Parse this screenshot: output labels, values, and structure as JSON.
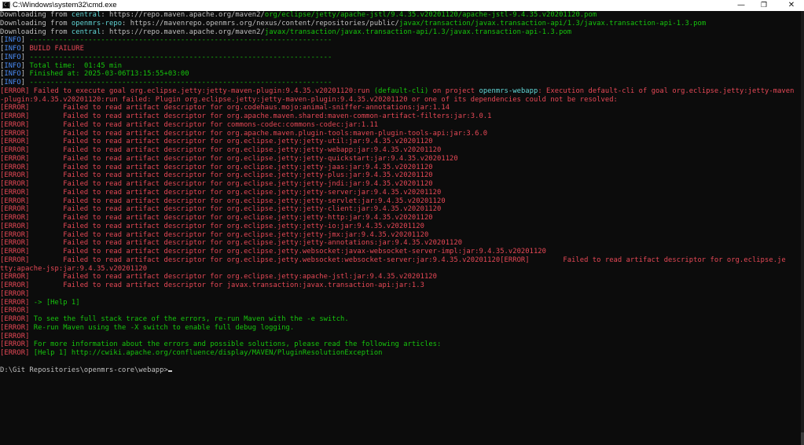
{
  "window": {
    "title": "C:\\Windows\\system32\\cmd.exe",
    "icon": "cmd-icon",
    "icon_glyph": "C:\\",
    "controls": {
      "minimize": "—",
      "maximize": "❐",
      "close": "✕"
    }
  },
  "colors": {
    "background": "#0c0c0c",
    "gray": "#c0c0c0",
    "green": "#16c60c",
    "cyan": "#61d6d6",
    "blue": "#4a8cf7",
    "red": "#e74856",
    "white": "#f2f2f2"
  },
  "console": {
    "lines": [
      [
        {
          "t": "Downloading from ",
          "c": "gray"
        },
        {
          "t": "central",
          "c": "cyan"
        },
        {
          "t": ": https://repo.maven.apache.org/maven2/",
          "c": "gray"
        },
        {
          "t": "org/eclipse/jetty/apache-jstl/9.4.35.v20201120/apache-jstl-9.4.35.v20201120.pom",
          "c": "green"
        }
      ],
      [
        {
          "t": "Downloading from ",
          "c": "gray"
        },
        {
          "t": "openmrs-repo",
          "c": "cyan"
        },
        {
          "t": ": https://mavenrepo.openmrs.org/nexus/content/repositories/public/",
          "c": "gray"
        },
        {
          "t": "javax/transaction/javax.transaction-api/1.3/javax.transaction-api-1.3.pom",
          "c": "green"
        }
      ],
      [
        {
          "t": "Downloading from ",
          "c": "gray"
        },
        {
          "t": "central",
          "c": "cyan"
        },
        {
          "t": ": https://repo.maven.apache.org/maven2/",
          "c": "gray"
        },
        {
          "t": "javax/transaction/javax.transaction-api/1.3/javax.transaction-api-1.3.pom",
          "c": "green"
        }
      ],
      [
        {
          "t": "[",
          "c": "gray"
        },
        {
          "t": "INFO",
          "c": "blue"
        },
        {
          "t": "] ",
          "c": "gray"
        },
        {
          "t": "------------------------------------------------------------------------",
          "c": "green"
        }
      ],
      [
        {
          "t": "[",
          "c": "gray"
        },
        {
          "t": "INFO",
          "c": "blue"
        },
        {
          "t": "] ",
          "c": "gray"
        },
        {
          "t": "BUILD FAILURE",
          "c": "red"
        }
      ],
      [
        {
          "t": "[",
          "c": "gray"
        },
        {
          "t": "INFO",
          "c": "blue"
        },
        {
          "t": "] ",
          "c": "gray"
        },
        {
          "t": "------------------------------------------------------------------------",
          "c": "green"
        }
      ],
      [
        {
          "t": "[",
          "c": "gray"
        },
        {
          "t": "INFO",
          "c": "blue"
        },
        {
          "t": "] ",
          "c": "gray"
        },
        {
          "t": "Total time:  01:45 min",
          "c": "green"
        }
      ],
      [
        {
          "t": "[",
          "c": "gray"
        },
        {
          "t": "INFO",
          "c": "blue"
        },
        {
          "t": "] ",
          "c": "gray"
        },
        {
          "t": "Finished at: 2025-03-06T13:15:55+03:00",
          "c": "green"
        }
      ],
      [
        {
          "t": "[",
          "c": "gray"
        },
        {
          "t": "INFO",
          "c": "blue"
        },
        {
          "t": "] ",
          "c": "gray"
        },
        {
          "t": "------------------------------------------------------------------------",
          "c": "green"
        }
      ],
      [
        {
          "t": "[ERROR] Failed to execute goal org.eclipse.jetty:jetty-maven-plugin:9.4.35.v20201120:run ",
          "c": "red"
        },
        {
          "t": "(default-cli)",
          "c": "green"
        },
        {
          "t": " on project ",
          "c": "red"
        },
        {
          "t": "openmrs-webapp",
          "c": "cyan"
        },
        {
          "t": ": Execution default-cli of goal org.eclipse.jetty:jetty-maven",
          "c": "red"
        }
      ],
      [
        {
          "t": "-plugin:9.4.35.v20201120:run failed: Plugin org.eclipse.jetty:jetty-maven-plugin:9.4.35.v20201120 or one of its dependencies could not be resolved:",
          "c": "red"
        }
      ],
      [
        {
          "t": "[ERROR]        Failed to read artifact descriptor for org.codehaus.mojo:animal-sniffer-annotations:jar:1.14",
          "c": "red"
        }
      ],
      [
        {
          "t": "[ERROR]        Failed to read artifact descriptor for org.apache.maven.shared:maven-common-artifact-filters:jar:3.0.1",
          "c": "red"
        }
      ],
      [
        {
          "t": "[ERROR]        Failed to read artifact descriptor for commons-codec:commons-codec:jar:1.11",
          "c": "red"
        }
      ],
      [
        {
          "t": "[ERROR]        Failed to read artifact descriptor for org.apache.maven.plugin-tools:maven-plugin-tools-api:jar:3.6.0",
          "c": "red"
        }
      ],
      [
        {
          "t": "[ERROR]        Failed to read artifact descriptor for org.eclipse.jetty:jetty-util:jar:9.4.35.v20201120",
          "c": "red"
        }
      ],
      [
        {
          "t": "[ERROR]        Failed to read artifact descriptor for org.eclipse.jetty:jetty-webapp:jar:9.4.35.v20201120",
          "c": "red"
        }
      ],
      [
        {
          "t": "[ERROR]        Failed to read artifact descriptor for org.eclipse.jetty:jetty-quickstart:jar:9.4.35.v20201120",
          "c": "red"
        }
      ],
      [
        {
          "t": "[ERROR]        Failed to read artifact descriptor for org.eclipse.jetty:jetty-jaas:jar:9.4.35.v20201120",
          "c": "red"
        }
      ],
      [
        {
          "t": "[ERROR]        Failed to read artifact descriptor for org.eclipse.jetty:jetty-plus:jar:9.4.35.v20201120",
          "c": "red"
        }
      ],
      [
        {
          "t": "[ERROR]        Failed to read artifact descriptor for org.eclipse.jetty:jetty-jndi:jar:9.4.35.v20201120",
          "c": "red"
        }
      ],
      [
        {
          "t": "[ERROR]        Failed to read artifact descriptor for org.eclipse.jetty:jetty-server:jar:9.4.35.v20201120",
          "c": "red"
        }
      ],
      [
        {
          "t": "[ERROR]        Failed to read artifact descriptor for org.eclipse.jetty:jetty-servlet:jar:9.4.35.v20201120",
          "c": "red"
        }
      ],
      [
        {
          "t": "[ERROR]        Failed to read artifact descriptor for org.eclipse.jetty:jetty-client:jar:9.4.35.v20201120",
          "c": "red"
        }
      ],
      [
        {
          "t": "[ERROR]        Failed to read artifact descriptor for org.eclipse.jetty:jetty-http:jar:9.4.35.v20201120",
          "c": "red"
        }
      ],
      [
        {
          "t": "[ERROR]        Failed to read artifact descriptor for org.eclipse.jetty:jetty-io:jar:9.4.35.v20201120",
          "c": "red"
        }
      ],
      [
        {
          "t": "[ERROR]        Failed to read artifact descriptor for org.eclipse.jetty:jetty-jmx:jar:9.4.35.v20201120",
          "c": "red"
        }
      ],
      [
        {
          "t": "[ERROR]        Failed to read artifact descriptor for org.eclipse.jetty:jetty-annotations:jar:9.4.35.v20201120",
          "c": "red"
        }
      ],
      [
        {
          "t": "[ERROR]        Failed to read artifact descriptor for org.eclipse.jetty.websocket:javax-websocket-server-impl:jar:9.4.35.v20201120",
          "c": "red"
        }
      ],
      [
        {
          "t": "[ERROR]        Failed to read artifact descriptor for org.eclipse.jetty.websocket:websocket-server:jar:9.4.35.v20201120[ERROR]        Failed to read artifact descriptor for org.eclipse.je",
          "c": "red"
        }
      ],
      [
        {
          "t": "tty:apache-jsp:jar:9.4.35.v20201120",
          "c": "red"
        }
      ],
      [
        {
          "t": "[ERROR]        Failed to read artifact descriptor for org.eclipse.jetty:apache-jstl:jar:9.4.35.v20201120",
          "c": "red"
        }
      ],
      [
        {
          "t": "[ERROR]        Failed to read artifact descriptor for javax.transaction:javax.transaction-api:jar:1.3",
          "c": "red"
        }
      ],
      [
        {
          "t": "[ERROR]",
          "c": "red"
        }
      ],
      [
        {
          "t": "[ERROR] ",
          "c": "red"
        },
        {
          "t": "-> [Help 1]",
          "c": "green"
        }
      ],
      [
        {
          "t": "[ERROR]",
          "c": "red"
        }
      ],
      [
        {
          "t": "[ERROR] ",
          "c": "red"
        },
        {
          "t": "To see the full stack trace of the errors, re-run Maven with the -e switch.",
          "c": "green"
        }
      ],
      [
        {
          "t": "[ERROR] ",
          "c": "red"
        },
        {
          "t": "Re-run Maven using the -X switch to enable full debug logging.",
          "c": "green"
        }
      ],
      [
        {
          "t": "[ERROR]",
          "c": "red"
        }
      ],
      [
        {
          "t": "[ERROR] ",
          "c": "red"
        },
        {
          "t": "For more information about the errors and possible solutions, please read the following articles:",
          "c": "green"
        }
      ],
      [
        {
          "t": "[ERROR] ",
          "c": "red"
        },
        {
          "t": "[Help 1] http://cwiki.apache.org/confluence/display/MAVEN/PluginResolutionException",
          "c": "green"
        }
      ],
      [
        {
          "t": "",
          "c": "gray"
        }
      ]
    ],
    "prompt": "D:\\Git Repositories\\openmrs-core\\webapp>"
  }
}
